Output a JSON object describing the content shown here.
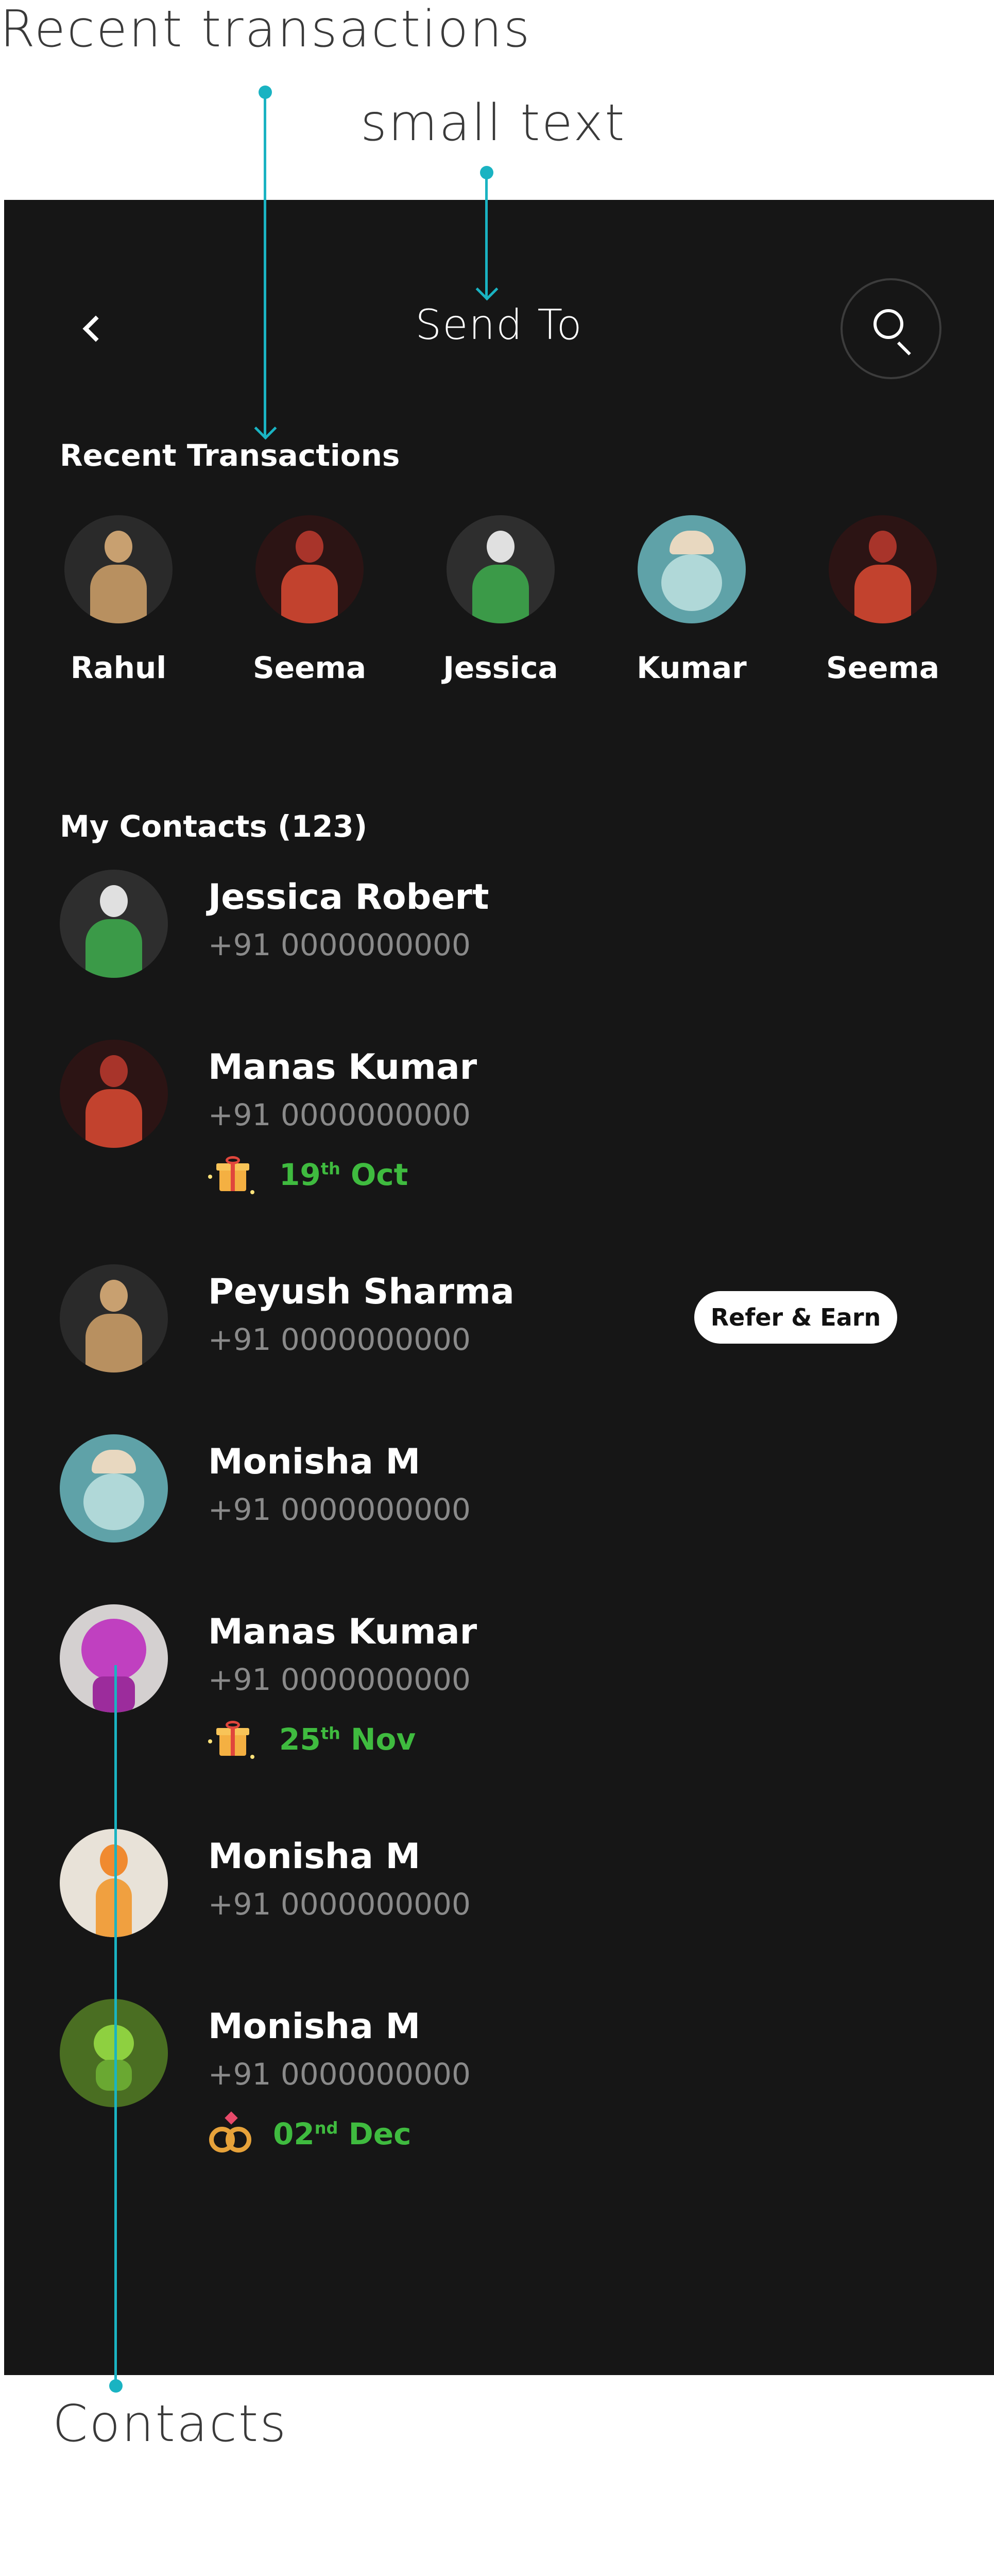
{
  "annotations": {
    "recent_transactions": "Recent transactions",
    "small_text": "small text",
    "contacts": "Contacts"
  },
  "header": {
    "title": "Send To",
    "back_icon": "chevron-left-icon",
    "search_icon": "search-icon"
  },
  "recent": {
    "heading": "Recent Transactions",
    "items": [
      {
        "name": "Rahul"
      },
      {
        "name": "Seema"
      },
      {
        "name": "Jessica"
      },
      {
        "name": "Kumar"
      },
      {
        "name": "Seema"
      }
    ]
  },
  "contacts": {
    "heading": "My Contacts (123)",
    "items": [
      {
        "name": "Jessica Robert",
        "phone": "+91 0000000000"
      },
      {
        "name": "Manas Kumar",
        "phone": "+91 0000000000",
        "event": {
          "icon": "gift-icon",
          "day": "19",
          "suffix": "th",
          "month": "Oct"
        }
      },
      {
        "name": "Peyush Sharma",
        "phone": "+91 0000000000",
        "action": "Refer & Earn"
      },
      {
        "name": "Monisha M",
        "phone": "+91 0000000000"
      },
      {
        "name": "Manas Kumar",
        "phone": "+91 0000000000",
        "event": {
          "icon": "gift-icon",
          "day": "25",
          "suffix": "th",
          "month": "Nov"
        }
      },
      {
        "name": "Monisha M",
        "phone": "+91 0000000000"
      },
      {
        "name": "Monisha M",
        "phone": "+91 0000000000",
        "event": {
          "icon": "rings-icon",
          "day": "02",
          "suffix": "nd",
          "month": "Dec"
        }
      }
    ]
  },
  "colors": {
    "background": "#161616",
    "annotation": "#1ab3c2",
    "event_text": "#3fbb3f",
    "secondary_text": "#8a8a8a"
  }
}
